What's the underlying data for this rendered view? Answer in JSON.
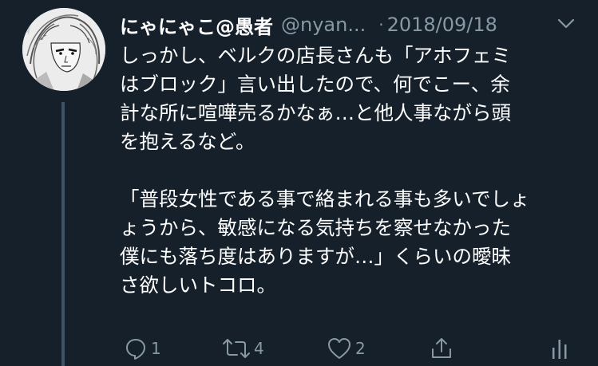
{
  "tweet": {
    "display_name": "にゃにゃこ@愚者",
    "handle": "@nyan...",
    "separator": "·",
    "date": "2018/09/18",
    "lines": [
      "しっかし、ベルクの店長さんも「アホフェミ",
      "はブロック」言い出したので、何でこー、余",
      "計な所に喧嘩売るかなぁ…と他人事ながら頭",
      "を抱えるなど。",
      "",
      "「普段女性である事で絡まれる事も多いでしょ",
      "ょうから、敏感になる気持ちを察せなかった",
      "僕にも落ち度はありますが…」くらいの曖昧",
      "さ欲しいトコロ。"
    ]
  },
  "actions": {
    "reply_count": "1",
    "retweet_count": "4",
    "like_count": "2"
  },
  "icons": {
    "menu": "chevron-down-icon",
    "reply": "reply-icon",
    "retweet": "retweet-icon",
    "like": "heart-icon",
    "share": "share-icon",
    "analytics": "analytics-icon"
  },
  "colors": {
    "background": "#15202b",
    "text": "#ffffff",
    "secondary": "#8899a6",
    "thread_line": "#3d5466"
  }
}
